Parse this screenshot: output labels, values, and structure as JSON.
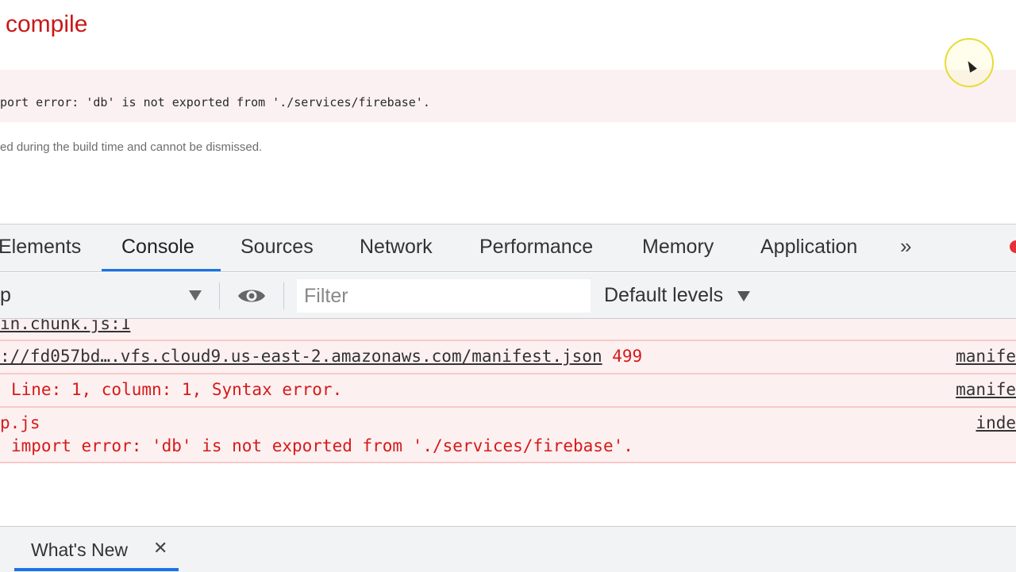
{
  "overlay": {
    "title": "compile",
    "error_text": "port error: 'db' is not exported from './services/firebase'.",
    "note": "ed during the build time and cannot be dismissed."
  },
  "devtools": {
    "tabs": [
      {
        "label": "Elements"
      },
      {
        "label": "Console"
      },
      {
        "label": "Sources"
      },
      {
        "label": "Network"
      },
      {
        "label": "Performance"
      },
      {
        "label": "Memory"
      },
      {
        "label": "Application"
      }
    ],
    "active_tab": "Console",
    "more_tabs_label": "»",
    "toolbar": {
      "context": "p",
      "filter_placeholder": "Filter",
      "levels": "Default levels"
    },
    "messages": [
      {
        "text": "in.chunk.js:1"
      },
      {
        "url": "://fd057bd….vfs.cloud9.us-east-2.amazonaws.com/manifest.json",
        "status": "499",
        "source": "manife"
      },
      {
        "text": "Line: 1, column: 1, Syntax error.",
        "source": "manife"
      },
      {
        "file": "p.js",
        "text": "import error: 'db' is not exported from './services/firebase'.",
        "source": "inde"
      }
    ],
    "drawer": {
      "tab": "What's New",
      "close": "✕"
    }
  },
  "colors": {
    "error_red": "#d51a1a",
    "accent_blue": "#1a73e8",
    "error_bg": "#fdf0f0"
  }
}
